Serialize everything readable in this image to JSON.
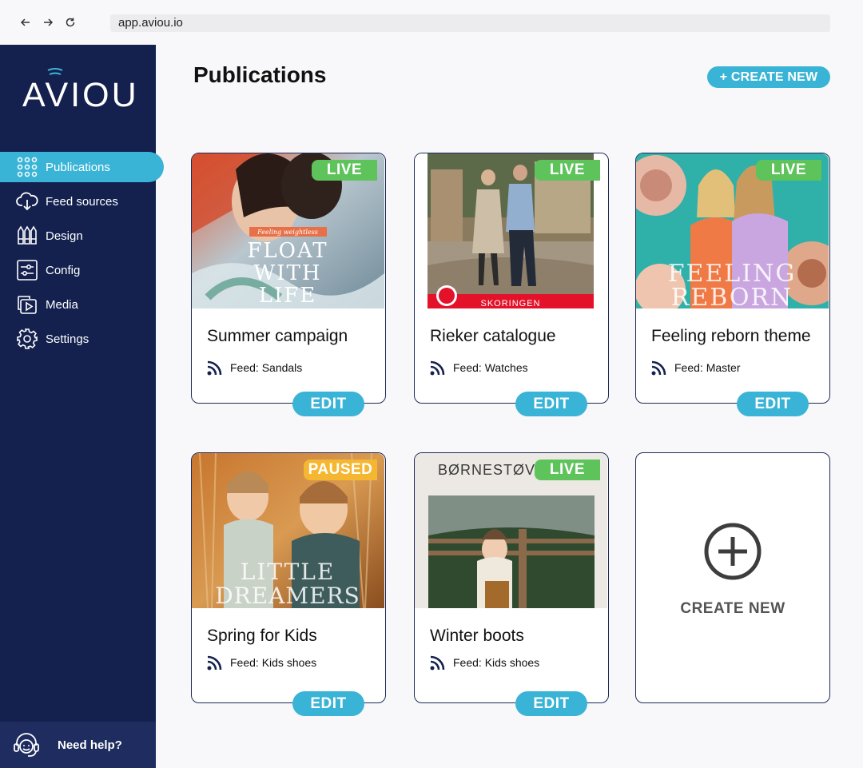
{
  "browser": {
    "url": "app.aviou.io",
    "back_icon": "arrow-left-icon",
    "forward_icon": "arrow-right-icon",
    "reload_icon": "reload-icon"
  },
  "sidebar": {
    "logo": "AVIOU",
    "items": [
      {
        "label": "Publications",
        "icon": "grid-icon",
        "active": true
      },
      {
        "label": "Feed sources",
        "icon": "cloud-download-icon",
        "active": false
      },
      {
        "label": "Design",
        "icon": "pens-icon",
        "active": false
      },
      {
        "label": "Config",
        "icon": "sliders-icon",
        "active": false
      },
      {
        "label": "Media",
        "icon": "media-icon",
        "active": false
      },
      {
        "label": "Settings",
        "icon": "gear-icon",
        "active": false
      }
    ],
    "help_label": "Need help?"
  },
  "main": {
    "title": "Publications",
    "create_button": "+ CREATE NEW",
    "publications": [
      {
        "title": "Summer campaign",
        "feed": "Feed: Sandals",
        "status": "LIVE",
        "edit": "EDIT",
        "image_text": [
          "Feeling weightless",
          "FLOAT",
          "WITH",
          "LIFE"
        ]
      },
      {
        "title": "Rieker catalogue",
        "feed": "Feed: Watches",
        "status": "LIVE",
        "edit": "EDIT",
        "image_text": [
          "SKORINGEN"
        ]
      },
      {
        "title": "Feeling reborn theme",
        "feed": "Feed: Master",
        "status": "LIVE",
        "edit": "EDIT",
        "image_text": [
          "FEELING",
          "REBORN"
        ]
      },
      {
        "title": "Spring for Kids",
        "feed": "Feed: Kids shoes",
        "status": "PAUSED",
        "edit": "EDIT",
        "image_text": [
          "LITTLE",
          "DREAMERS"
        ]
      },
      {
        "title": "Winter boots",
        "feed": "Feed: Kids shoes",
        "status": "LIVE",
        "edit": "EDIT",
        "image_text": [
          "BØRNESTØV"
        ]
      }
    ],
    "create_card_label": "CREATE NEW"
  },
  "colors": {
    "sidebar": "#14214f",
    "accent": "#3ab4d6",
    "live": "#5fc35c",
    "paused": "#f5b731",
    "card_border": "#1d2a5a"
  }
}
